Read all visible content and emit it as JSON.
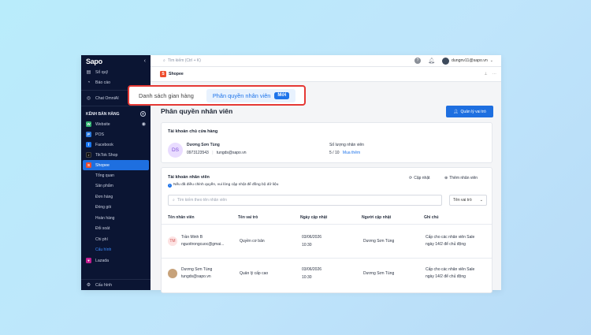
{
  "sidebar": {
    "logo": "Sapo",
    "top_items": [
      {
        "label": "Sổ quỹ",
        "icon": "wallet-icon"
      },
      {
        "label": "Báo cáo",
        "icon": "report-icon"
      },
      {
        "label": "Chat OmniAI",
        "icon": "chat-icon"
      }
    ],
    "section_title": "KÊNH BÁN HÀNG",
    "channels": [
      {
        "label": "Website",
        "color": "#2fb36f"
      },
      {
        "label": "POS",
        "color": "#2f7de1"
      },
      {
        "label": "Facebook",
        "color": "#1877f2"
      },
      {
        "label": "TikTok Shop",
        "color": "#111111"
      },
      {
        "label": "Shopee",
        "color": "#ee4d2d"
      }
    ],
    "sub_items": [
      "Tổng quan",
      "Sản phẩm",
      "Đơn hàng",
      "Đóng gói",
      "Hoàn hàng",
      "Đối soát",
      "Chi phí",
      "Cấu hình"
    ],
    "lazada": "Lazada",
    "settings": "Cấu hình"
  },
  "topbar": {
    "search_placeholder": "Tìm kiếm (Ctrl + K)",
    "user": "dungnv11@sapo.vn"
  },
  "subheader": {
    "shop": "Shopee"
  },
  "tabs": {
    "tab1": "Danh sách gian hàng",
    "tab2": "Phân quyền nhân viên",
    "badge": "Mới"
  },
  "page": {
    "title": "Phân quyền nhân viên",
    "manage_button": "Quản lý vai trò"
  },
  "owner_card": {
    "title": "Tài khoản chủ cửa hàng",
    "avatar": "DS",
    "name": "Dương Sơn Tùng",
    "phone": "0973123543",
    "email": "tungds@sapo.vn",
    "quota_label": "Số lượng nhân viên",
    "quota_value": "5 / 10",
    "buy_more": "Mua thêm"
  },
  "staff_card": {
    "title": "Tài khoản nhân viên",
    "notice": "Nếu đã điều chỉnh quyền, vui lòng cập nhật để đồng bộ dữ liệu",
    "refresh": "Cập nhật",
    "add": "Thêm nhân viên",
    "search_placeholder": "Tìm kiếm theo tên nhân viên",
    "role_filter": "Tên vai trò",
    "headers": [
      "Tên nhân viên",
      "Tên vai trò",
      "Ngày cập nhật",
      "Người cập nhật",
      "Ghi chú"
    ],
    "rows": [
      {
        "avatar": "TM",
        "name": "Trần Minh B",
        "email": "nguoitrongcuoc@gmai...",
        "role": "Quyền cơ bản",
        "date": "03/06/2026",
        "time": "10:30",
        "updater": "Dương Sơn Tùng",
        "note1": "Cấp cho các nhân viên Sale",
        "note2": "ngày 14/2 để chủ động"
      },
      {
        "avatar": "",
        "name": "Dương Sơn Tùng",
        "email": "tungds@sapo.vn",
        "role": "Quản lý cấp cao",
        "date": "03/06/2026",
        "time": "10:30",
        "updater": "Dương Sơn Tùng",
        "note1": "Cấp cho các nhân viên Sale",
        "note2": "ngày 14/2 để chủ động"
      }
    ]
  }
}
